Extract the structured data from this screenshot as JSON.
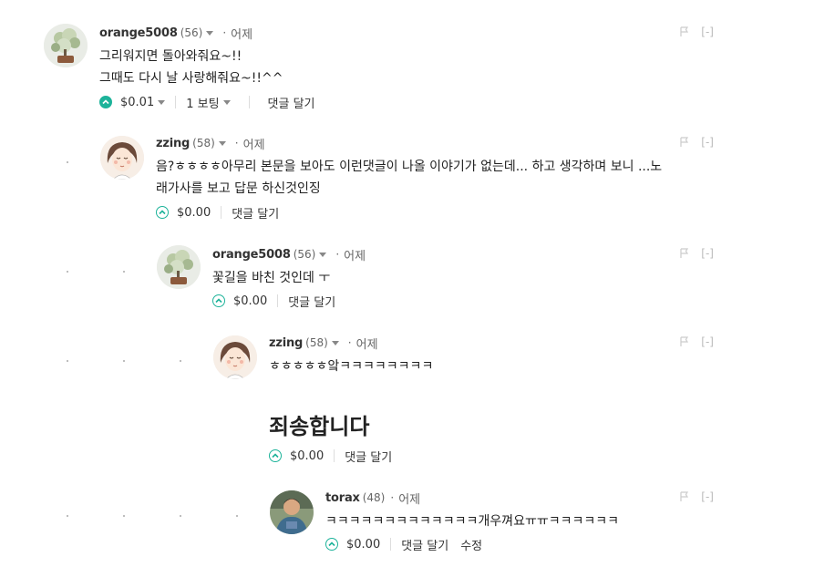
{
  "comments": [
    {
      "author": "orange5008",
      "rep": "(56)",
      "time": "어제",
      "lines": [
        "그리워지면 돌아와줘요~!!",
        "그때도 다시 날 사랑해줘요~!!^^"
      ],
      "payout": "$0.01",
      "votes": "1 보팅",
      "reply": "댓글 달기",
      "collapse": "[-]"
    },
    {
      "author": "zzing",
      "rep": "(58)",
      "time": "어제",
      "lines": [
        "음?ㅎㅎㅎㅎ아무리 본문을 보아도 이런댓글이 나올 이야기가 없는데... 하고 생각하며 보니 ...노",
        "래가사를 보고 답문 하신것인징"
      ],
      "payout": "$0.00",
      "reply": "댓글 달기",
      "collapse": "[-]"
    },
    {
      "author": "orange5008",
      "rep": "(56)",
      "time": "어제",
      "lines": [
        "꽃길을 바친 것인데 ㅜ"
      ],
      "payout": "$0.00",
      "reply": "댓글 달기",
      "collapse": "[-]"
    },
    {
      "author": "zzing",
      "rep": "(58)",
      "time": "어제",
      "lines": [
        "ㅎㅎㅎㅎㅎ앜ㅋㅋㅋㅋㅋㅋㅋㅋ"
      ],
      "heading": "죄송합니다",
      "payout": "$0.00",
      "reply": "댓글 달기",
      "collapse": "[-]"
    },
    {
      "author": "torax",
      "rep": "(48)",
      "time": "어제",
      "lines": [
        "ㅋㅋㅋㅋㅋㅋㅋㅋㅋㅋㅋㅋㅋ개우껴요ㅠㅠㅋㅋㅋㅋㅋㅋ"
      ],
      "payout": "$0.00",
      "reply": "댓글 달기",
      "edit": "수정",
      "collapse": "[-]"
    }
  ],
  "colors": {
    "accent": "#1db39a",
    "text": "#222222",
    "muted": "#888888"
  },
  "icons": {
    "vote": "upvote-chevron-icon",
    "flag": "flag-icon",
    "caret": "caret-down-icon"
  }
}
